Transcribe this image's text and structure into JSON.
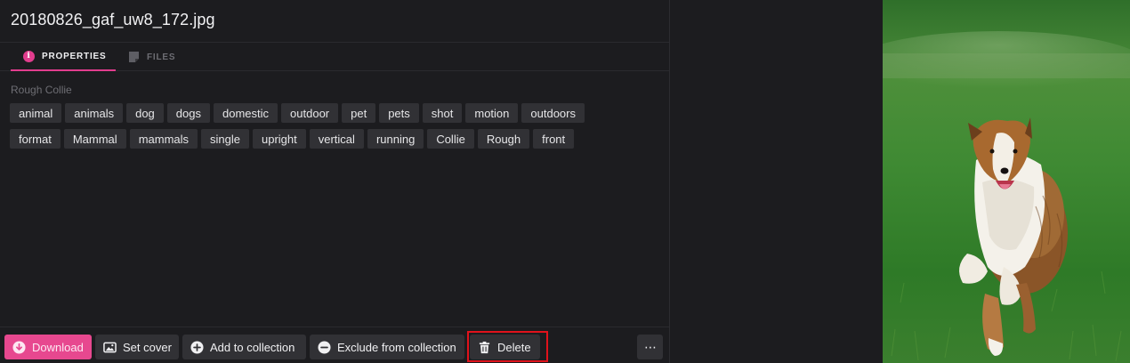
{
  "file": {
    "title": "20180826_gaf_uw8_172.jpg"
  },
  "tabs": [
    {
      "label": "PROPERTIES",
      "active": true,
      "icon": "info-icon"
    },
    {
      "label": "FILES",
      "active": false,
      "icon": "file-icon"
    }
  ],
  "properties": {
    "subtitle": "Rough Collie",
    "tags_row1": [
      "animal",
      "animals",
      "dog",
      "dogs",
      "domestic",
      "outdoor",
      "pet",
      "pets",
      "shot",
      "motion",
      "outdoors"
    ],
    "tags_row2": [
      "format",
      "Mammal",
      "mammals",
      "single",
      "upright",
      "vertical",
      "running",
      "Collie",
      "Rough",
      "front"
    ]
  },
  "toolbar": {
    "download": "Download",
    "set_cover": "Set cover",
    "add_collection": "Add to collection",
    "exclude_collection": "Exclude from collection",
    "delete": "Delete",
    "more": "⋯"
  },
  "colors": {
    "accent": "#e7488f",
    "highlight": "#e0121b",
    "background": "#1c1c1f",
    "tag_bg": "#313135"
  },
  "preview": {
    "subject": "collie dog running on grass"
  }
}
